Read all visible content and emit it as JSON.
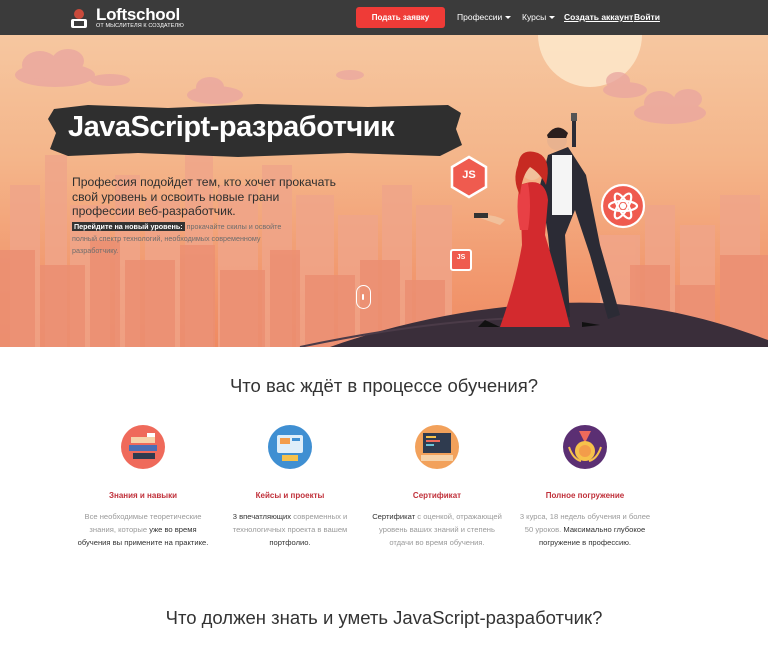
{
  "header": {
    "logo_name": "Loftschool",
    "logo_tagline": "ОТ МЫСЛИТЕЛЯ К СОЗДАТЕЛЮ",
    "cta_label": "Подать заявку",
    "nav": [
      {
        "label": "Профессии"
      },
      {
        "label": "Курсы"
      }
    ],
    "create_account": "Создать аккаунт",
    "login": "Войти"
  },
  "hero": {
    "title": "JavaScript-разработчик",
    "description": "Профессия подойдет тем, кто хочет прокачать свой уровень и освоить новые грани профессии веб-разработчик.",
    "sub_highlight": "Перейдите на новый уровень:",
    "sub_text": " прокачайте скилы и освойте полный спектр технологий, необходимых современному разработчику.",
    "badge_js": "JS",
    "badge_js_small": "JS"
  },
  "learning": {
    "title": "Что вас ждёт в процессе обучения?",
    "features": [
      {
        "title": "Знания и навыки",
        "p1": "Все необходимые теоретические знания, которые ",
        "b1": "уже во время обучения вы примените на практике.",
        "p2": "",
        "b2": ""
      },
      {
        "title": "Кейсы и проекты",
        "p1": "",
        "b1": "3 впечатляющих",
        "p2": " современных и технологичных проекта в вашем ",
        "b2": "портфолио."
      },
      {
        "title": "Сертификат",
        "p1": "",
        "b1": "Сертификат",
        "p2": " с оценкой, отражающей уровень ваших знаний и степень отдачи во время обучения.",
        "b2": ""
      },
      {
        "title": "Полное погружение",
        "p1": "3 курса, 18 недель обучения и более 50 уроков. ",
        "b1": "Максимально глубокое погружение в профессию.",
        "p2": "",
        "b2": ""
      }
    ]
  },
  "skills": {
    "title": "Что должен знать и уметь JavaScript-разработчик?"
  },
  "colors": {
    "topbar": "#3b3b3b",
    "cta": "#ef3b37",
    "accent_title": "#c0303a"
  }
}
